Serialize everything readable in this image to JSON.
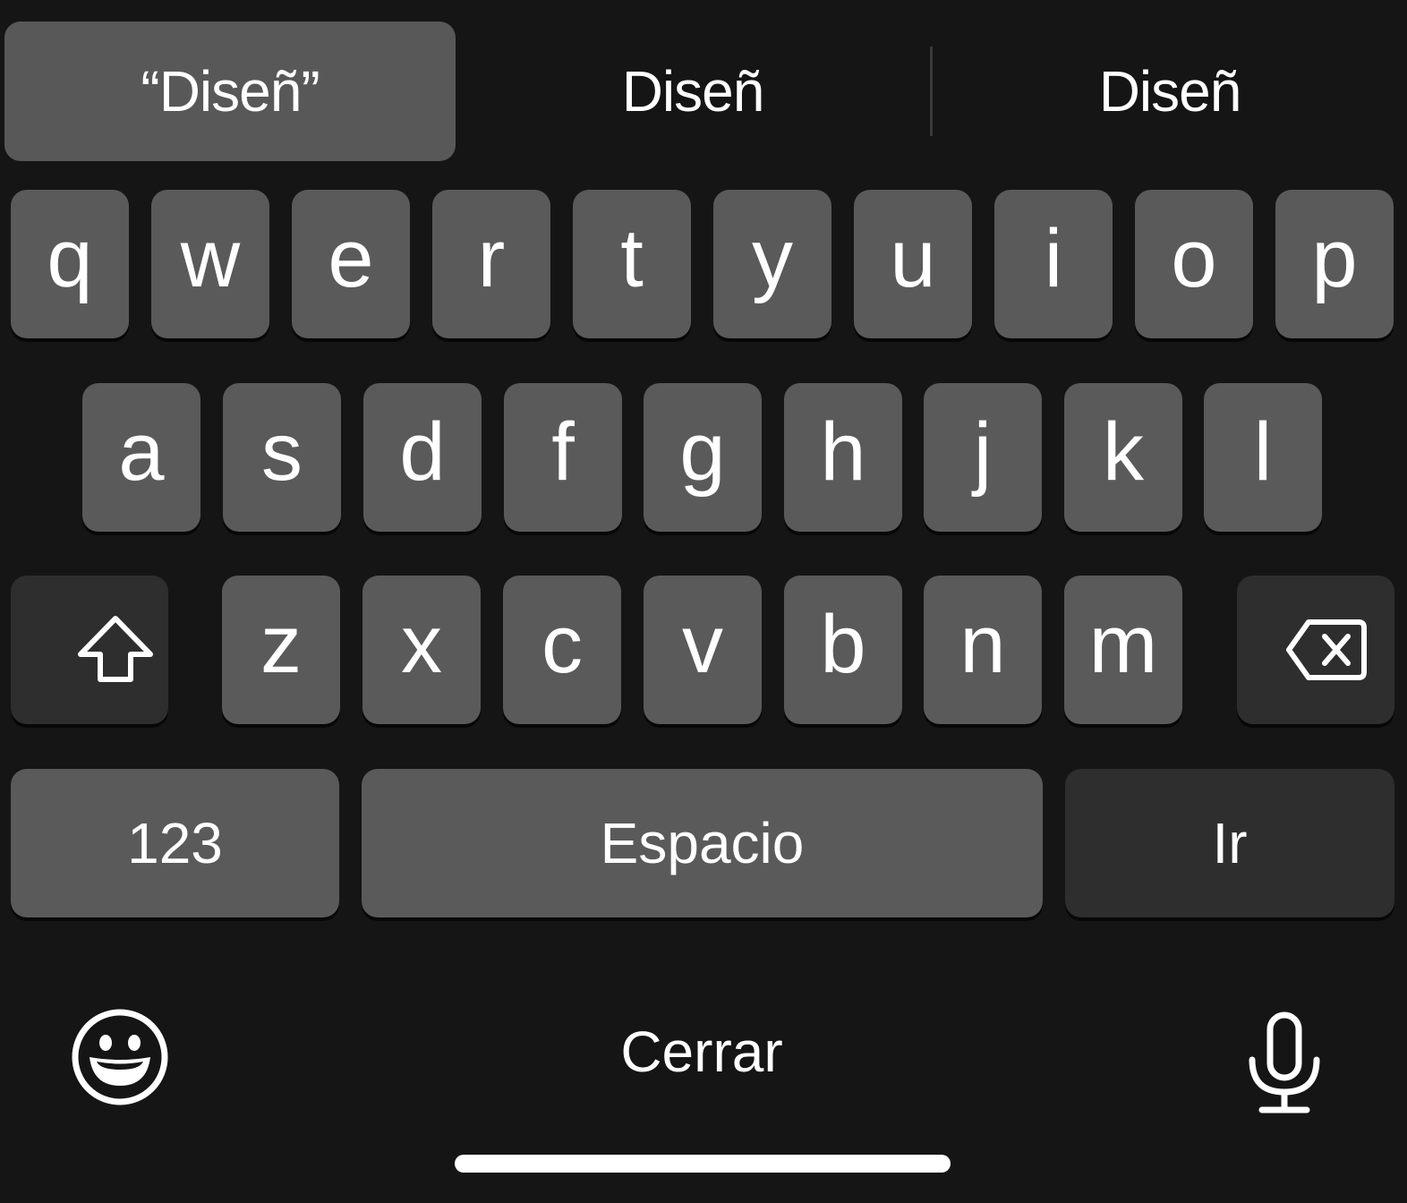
{
  "predictions": {
    "quoted": "“Diseñ”",
    "second": "Diseñ",
    "third": "Diseñ"
  },
  "keyboard": {
    "row1": [
      "q",
      "w",
      "e",
      "r",
      "t",
      "y",
      "u",
      "i",
      "o",
      "p"
    ],
    "row2": [
      "a",
      "s",
      "d",
      "f",
      "g",
      "h",
      "j",
      "k",
      "l"
    ],
    "row3": [
      "z",
      "x",
      "c",
      "v",
      "b",
      "n",
      "m"
    ],
    "numbers_label": "123",
    "space_label": "Espacio",
    "go_label": "Ir",
    "shift_icon": "shift-icon",
    "delete_icon": "delete-icon"
  },
  "bottom_bar": {
    "emoji_icon": "emoji-icon",
    "close_label": "Cerrar",
    "mic_icon": "microphone-icon"
  },
  "colors": {
    "background": "#151515",
    "key": "#5a5a5a",
    "function_key": "#2e2e2e",
    "text": "#ffffff"
  }
}
